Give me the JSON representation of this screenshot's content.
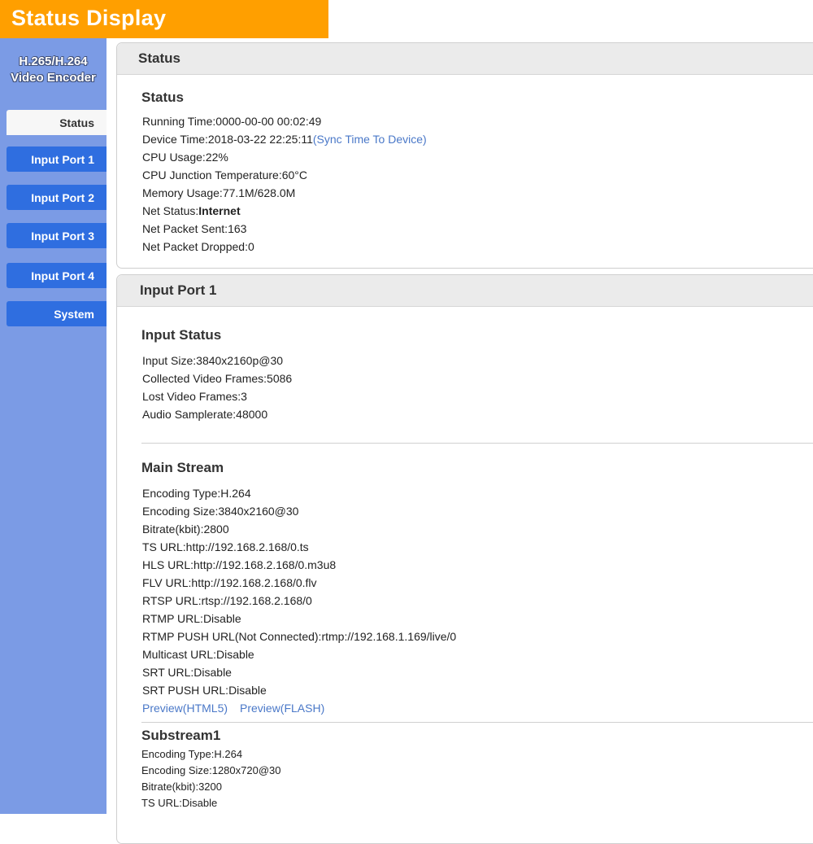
{
  "header": {
    "title": "Status Display"
  },
  "sidebar": {
    "product_line1": "H.265/H.264",
    "product_line2": "Video Encoder",
    "items": [
      {
        "label": "Status",
        "active": true
      },
      {
        "label": "Input Port 1"
      },
      {
        "label": "Input Port 2"
      },
      {
        "label": "Input Port 3"
      },
      {
        "label": "Input Port 4"
      },
      {
        "label": "System"
      }
    ]
  },
  "status_panel": {
    "header": "Status",
    "title": "Status",
    "running_time": {
      "label": "Running Time:",
      "value": "0000-00-00 00:02:49"
    },
    "device_time": {
      "label": "Device Time:",
      "value": "2018-03-22 22:25:11",
      "link": "(Sync Time To Device)"
    },
    "cpu_usage": {
      "label": "CPU Usage:",
      "value": "22%"
    },
    "cpu_temp": {
      "label": "CPU Junction Temperature:",
      "value": "60°C"
    },
    "memory": {
      "label": "Memory Usage:",
      "value": "77.1M/628.0M"
    },
    "net_status": {
      "label": "Net Status:",
      "value": "Internet"
    },
    "packets_sent": {
      "label": "Net Packet Sent:",
      "value": "163"
    },
    "packets_dropped": {
      "label": "Net Packet Dropped:",
      "value": "0"
    }
  },
  "input_panel": {
    "header": "Input Port 1",
    "input_status": {
      "title": "Input Status",
      "rows": [
        "Input Size:3840x2160p@30",
        "Collected Video Frames:5086",
        "Lost Video Frames:3",
        "Audio Samplerate:48000"
      ]
    },
    "main_stream": {
      "title": "Main Stream",
      "rows": [
        "Encoding Type:H.264",
        "Encoding Size:3840x2160@30",
        "Bitrate(kbit):2800",
        "TS URL:http://192.168.2.168/0.ts",
        "HLS URL:http://192.168.2.168/0.m3u8",
        "FLV URL:http://192.168.2.168/0.flv",
        "RTSP URL:rtsp://192.168.2.168/0",
        "RTMP URL:Disable",
        "RTMP PUSH URL(Not Connected):rtmp://192.168.1.169/live/0",
        "Multicast URL:Disable",
        "SRT URL:Disable",
        "SRT PUSH URL:Disable"
      ],
      "preview_html5": "Preview(HTML5)",
      "preview_flash": "Preview(FLASH)"
    },
    "substream1": {
      "title": "Substream1",
      "rows": [
        "Encoding Type:H.264",
        "Encoding Size:1280x720@30",
        "Bitrate(kbit):3200",
        "TS URL:Disable"
      ]
    }
  }
}
